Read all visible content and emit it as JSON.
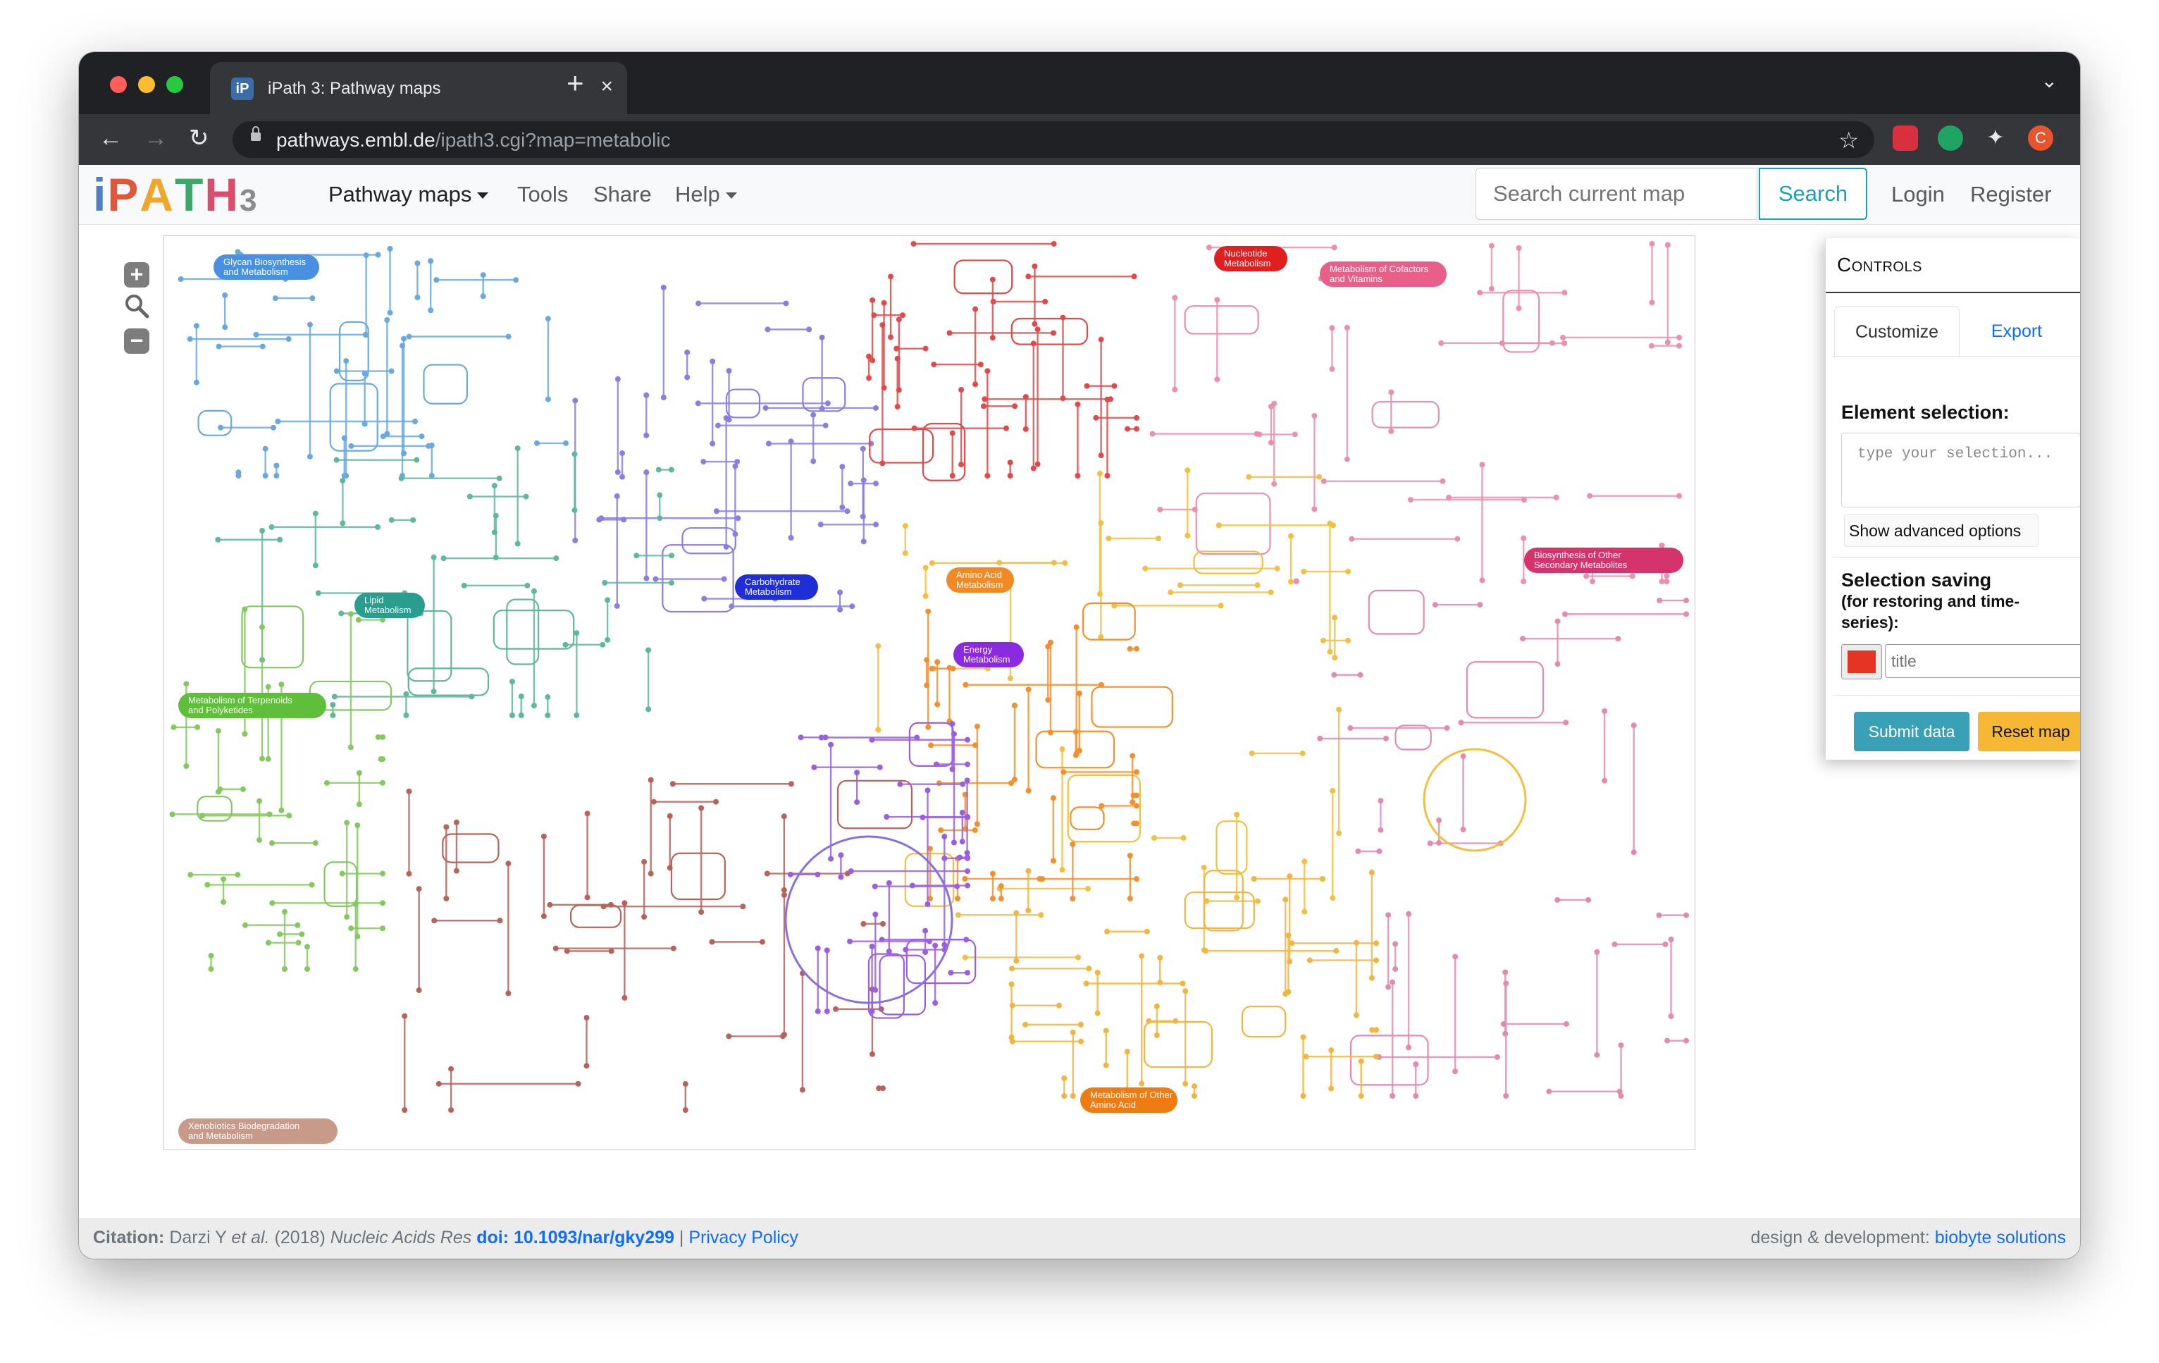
{
  "browser": {
    "tab_title": "iPath 3: Pathway maps",
    "tab_favicon_text": "iP",
    "tab_close": "×",
    "new_tab": "+",
    "url_host": "pathways.embl.de",
    "url_path": "/ipath3.cgi?map=metabolic",
    "profile_initial": "C",
    "nav_back": "←",
    "nav_forward": "→",
    "nav_reload": "↻",
    "bookmark_icon": "☆",
    "menu_icon": "⋮",
    "tab_list_icon": "⌄"
  },
  "navbar": {
    "logo_text": "iPATH3",
    "menu": [
      {
        "label": "Pathway maps",
        "dropdown": true
      },
      {
        "label": "Tools",
        "dropdown": false
      },
      {
        "label": "Share",
        "dropdown": false
      },
      {
        "label": "Help",
        "dropdown": true
      }
    ],
    "search_placeholder": "Search current map",
    "search_button": "Search",
    "login": "Login",
    "register": "Register"
  },
  "zoom": {
    "zoom_in": "+",
    "zoom_out": "−"
  },
  "map": {
    "category_labels": [
      {
        "text": "Glycan Biosynthesis and Metabolism",
        "color": "#4a90e2"
      },
      {
        "text": "Nucleotide Metabolism",
        "color": "#e02020"
      },
      {
        "text": "Metabolism of Cofactors and Vitamins",
        "color": "#e8608a"
      },
      {
        "text": "Lipid Metabolism",
        "color": "#2a9d8f"
      },
      {
        "text": "Carbohydrate Metabolism",
        "color": "#1f2ed6"
      },
      {
        "text": "Amino Acid Metabolism",
        "color": "#f08a24"
      },
      {
        "text": "Energy Metabolism",
        "color": "#8a2be2"
      },
      {
        "text": "Biosynthesis of Other Secondary Metabolites",
        "color": "#d6336c"
      },
      {
        "text": "Metabolism of Terpenoids and Polyketides",
        "color": "#5fbf3a"
      },
      {
        "text": "Xenobiotics Biodegradation and Metabolism",
        "color": "#c79a8a"
      },
      {
        "text": "Metabolism of Other Amino Acid",
        "color": "#f07b10"
      }
    ]
  },
  "controls": {
    "title": "Controls",
    "tabs": [
      "Customize",
      "Export"
    ],
    "element_selection_label": "Element selection:",
    "selection_placeholder": "type your selection...",
    "advanced_options": "Show advanced options",
    "selection_saving_label": "Selection saving",
    "selection_saving_sub": "(for restoring and time-series):",
    "title_placeholder": "title",
    "color_value": "#e53424",
    "submit_button": "Submit data",
    "reset_button": "Reset map"
  },
  "footer": {
    "citation_label": "Citation:",
    "citation_authors": "Darzi Y",
    "citation_etal": "et al.",
    "citation_year": "(2018)",
    "citation_journal": "Nucleic Acids Res",
    "doi": "doi: 10.1093/nar/gky299",
    "separator": "|",
    "privacy": "Privacy Policy",
    "credit_label": "design & development:",
    "credit_link": "biobyte solutions"
  }
}
